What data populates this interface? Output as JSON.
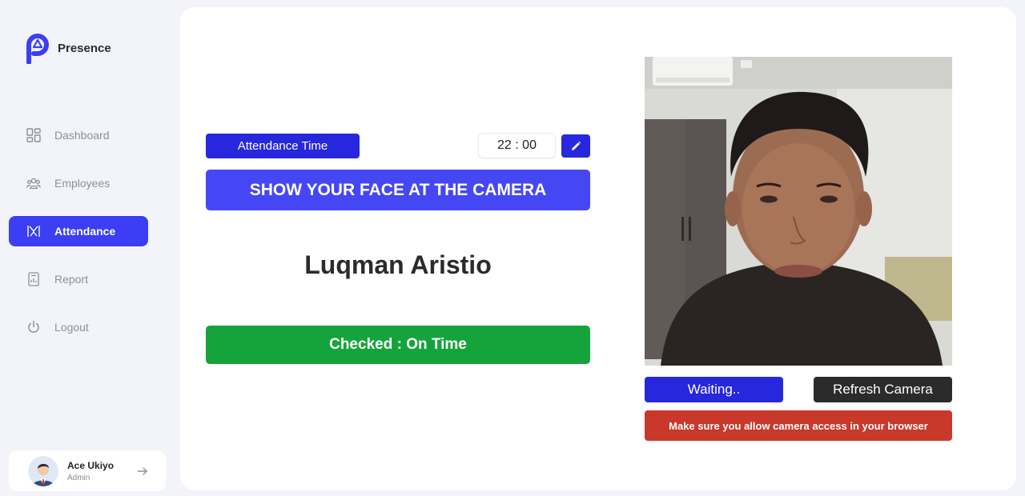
{
  "app": {
    "name": "Presence"
  },
  "sidebar": {
    "items": [
      {
        "label": "Dashboard",
        "icon": "dashboard-icon"
      },
      {
        "label": "Employees",
        "icon": "employees-icon"
      },
      {
        "label": "Attendance",
        "icon": "attendance-icon",
        "active": true
      },
      {
        "label": "Report",
        "icon": "report-icon"
      },
      {
        "label": "Logout",
        "icon": "power-icon"
      }
    ]
  },
  "user": {
    "name": "Ace Ukiyo",
    "role": "Admin"
  },
  "attendance": {
    "time_label": "Attendance Time",
    "time_value": "22 : 00",
    "instruction": "SHOW YOUR FACE AT THE CAMERA",
    "person_name": "Luqman Aristio",
    "status": "Checked : On Time"
  },
  "camera": {
    "waiting_label": "Waiting..",
    "refresh_label": "Refresh Camera",
    "warning": "Make sure you allow camera access in your browser"
  },
  "colors": {
    "accent": "#2727de",
    "banner": "#4547f5",
    "success": "#15a33b",
    "danger": "#c8382b",
    "dark": "#2b2b2b"
  }
}
